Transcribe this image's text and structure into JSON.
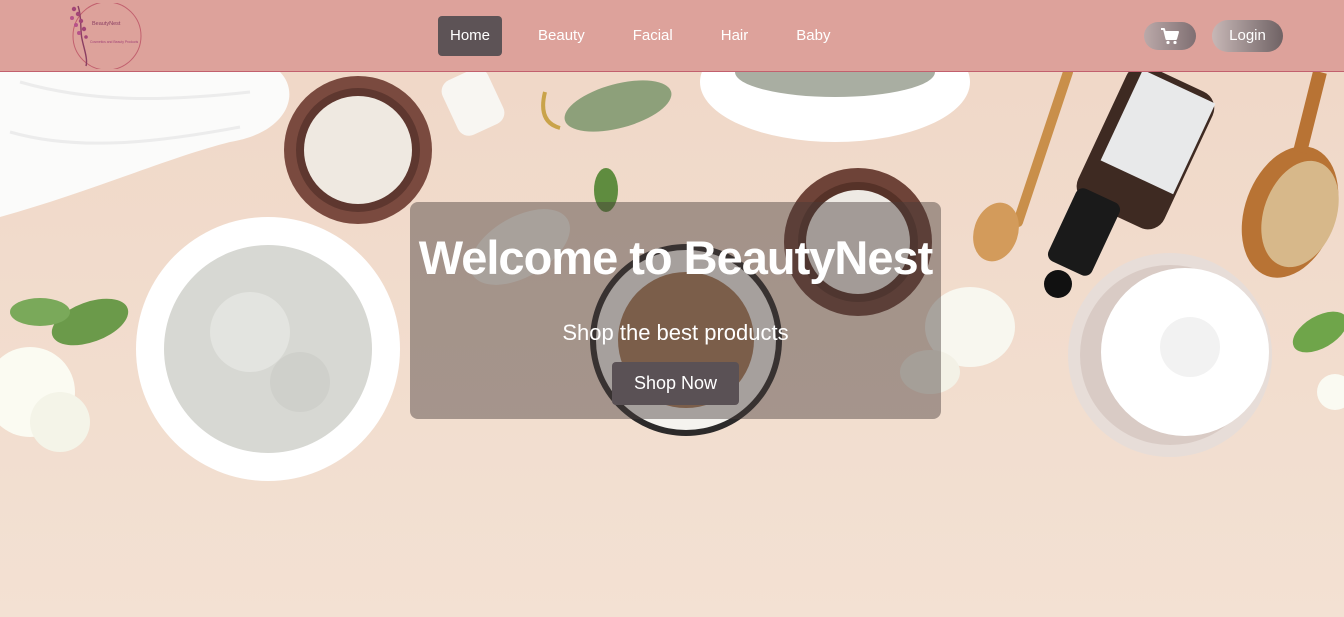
{
  "brand": {
    "name": "BeautyNest",
    "tagline": "Cosmetics and Beauty Products"
  },
  "nav": {
    "items": [
      {
        "label": "Home",
        "active": true
      },
      {
        "label": "Beauty"
      },
      {
        "label": "Facial"
      },
      {
        "label": "Hair"
      },
      {
        "label": "Baby"
      }
    ]
  },
  "header": {
    "login_label": "Login",
    "cart_icon": "shopping-cart-icon"
  },
  "hero": {
    "title": "Welcome to BeautyNest",
    "subtitle": "Shop the best products",
    "cta_label": "Shop Now"
  },
  "colors": {
    "navbar": "#dda29b",
    "brand_accent": "#c2606e",
    "button_dark": "#5a5155",
    "hero_background": "#f3e2d6"
  }
}
